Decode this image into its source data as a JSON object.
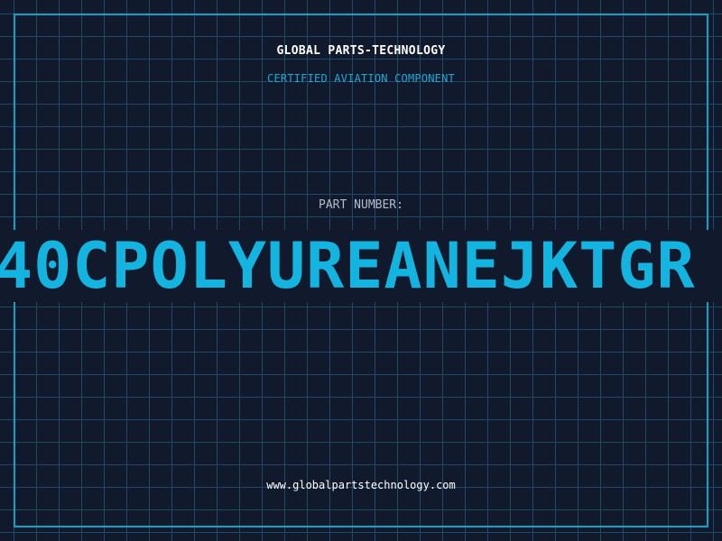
{
  "header": {
    "brand": "GLOBAL PARTS-TECHNOLOGY",
    "tagline": "CERTIFIED AVIATION COMPONENT"
  },
  "part": {
    "label": "PART NUMBER:",
    "number": "40CPOLYUREANEJKTGR"
  },
  "footer": {
    "website": "www.globalpartstechnology.com"
  },
  "colors": {
    "background": "#111a2d",
    "grid": "#1e4b63",
    "frame": "#0fa3c7",
    "accent": "#14b4e0"
  }
}
